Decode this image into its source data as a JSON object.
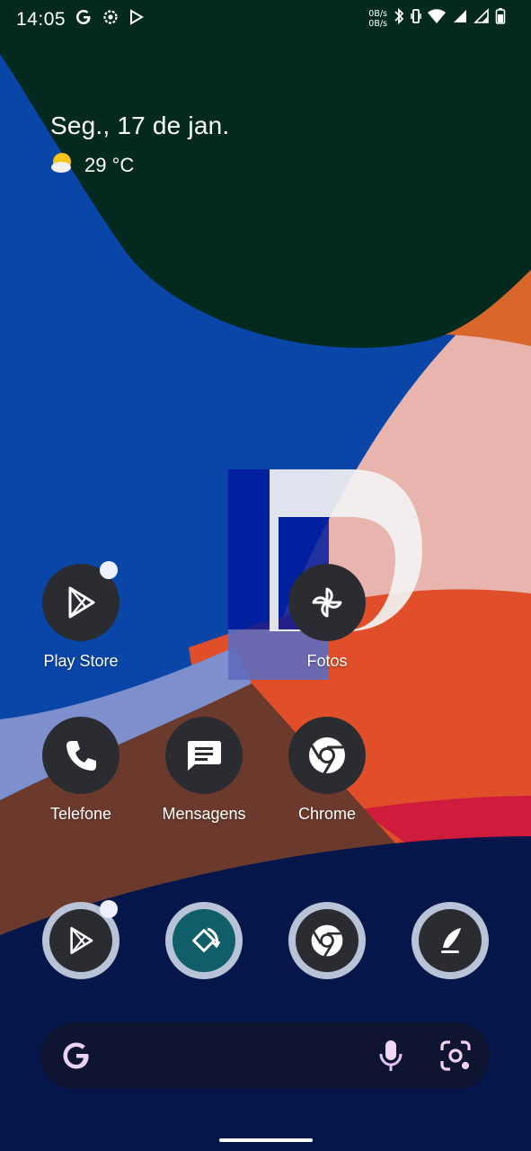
{
  "status_bar": {
    "time": "14:05",
    "net_up": "0B/s",
    "net_down": "0B/s",
    "left_icons": [
      "google-g-icon",
      "settings-gear-icon",
      "play-store-small-icon"
    ],
    "right_icons": [
      "bluetooth-icon",
      "vibrate-icon",
      "wifi-icon",
      "signal-icon",
      "signal-icon",
      "battery-icon"
    ]
  },
  "widget": {
    "date": "Seg., 17 de jan.",
    "temperature": "29 °C",
    "weather_icon": "partly-sunny-icon"
  },
  "home_apps": [
    {
      "label": "Play Store",
      "icon": "play-store-icon",
      "notification": true
    },
    {
      "label": "Fotos",
      "icon": "pinwheel-icon",
      "notification": false
    },
    {
      "label": "Telefone",
      "icon": "phone-icon",
      "notification": false
    },
    {
      "label": "Mensagens",
      "icon": "message-icon",
      "notification": false
    },
    {
      "label": "Chrome",
      "icon": "chrome-icon",
      "notification": false
    }
  ],
  "dock": [
    {
      "icon": "play-store-icon",
      "notification": true
    },
    {
      "icon": "rotate-icon",
      "notification": false
    },
    {
      "icon": "chrome-icon",
      "notification": false
    },
    {
      "icon": "feather-pen-icon",
      "notification": false
    }
  ],
  "search": {
    "icons": [
      "google-g-icon",
      "mic-icon",
      "lens-icon"
    ]
  },
  "colors": {
    "dark_green": "#04291f",
    "blue": "#0a46a8",
    "orange": "#d9662a",
    "pink": "#e8b4ad",
    "red_orange": "#e04e2a",
    "crimson": "#cf1c3c",
    "navy": "#05174a",
    "brown": "#6c3a2c",
    "icon_bg": "#2b2c31"
  }
}
